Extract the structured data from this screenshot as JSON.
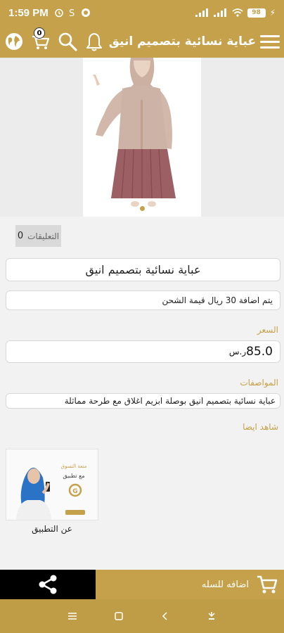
{
  "status_bar": {
    "time": "1:59 PM",
    "battery": "98"
  },
  "app_bar": {
    "title": "عباية نسائية بتصميم انيق",
    "cart_count": "0"
  },
  "product": {
    "comments_count": "0",
    "comments_label": "التعليقات",
    "name": "عباية نسائية بتصميم انيق",
    "shipping_note": "يتم اضافة 30 ريال قيمة الشحن",
    "price_label": "السعر",
    "price_value": "85.0",
    "currency": "ر.س",
    "specs_label": "المواصفات",
    "specs_value": "عباية نسائية بتصميم انيق بوصلة ابزيم اغلاق مع طرحة مماثلة"
  },
  "related": {
    "section_label": "شاهد ايضا",
    "items": [
      {
        "label": "عن التطبيق",
        "promo_line1": "متعة التسوق",
        "promo_line2": "مع تطبيق",
        "brand": "G"
      }
    ]
  },
  "bottom_actions": {
    "add_to_cart": "اضافه للسله"
  },
  "colors": {
    "primary": "#c4a14a",
    "dark": "#000000"
  }
}
